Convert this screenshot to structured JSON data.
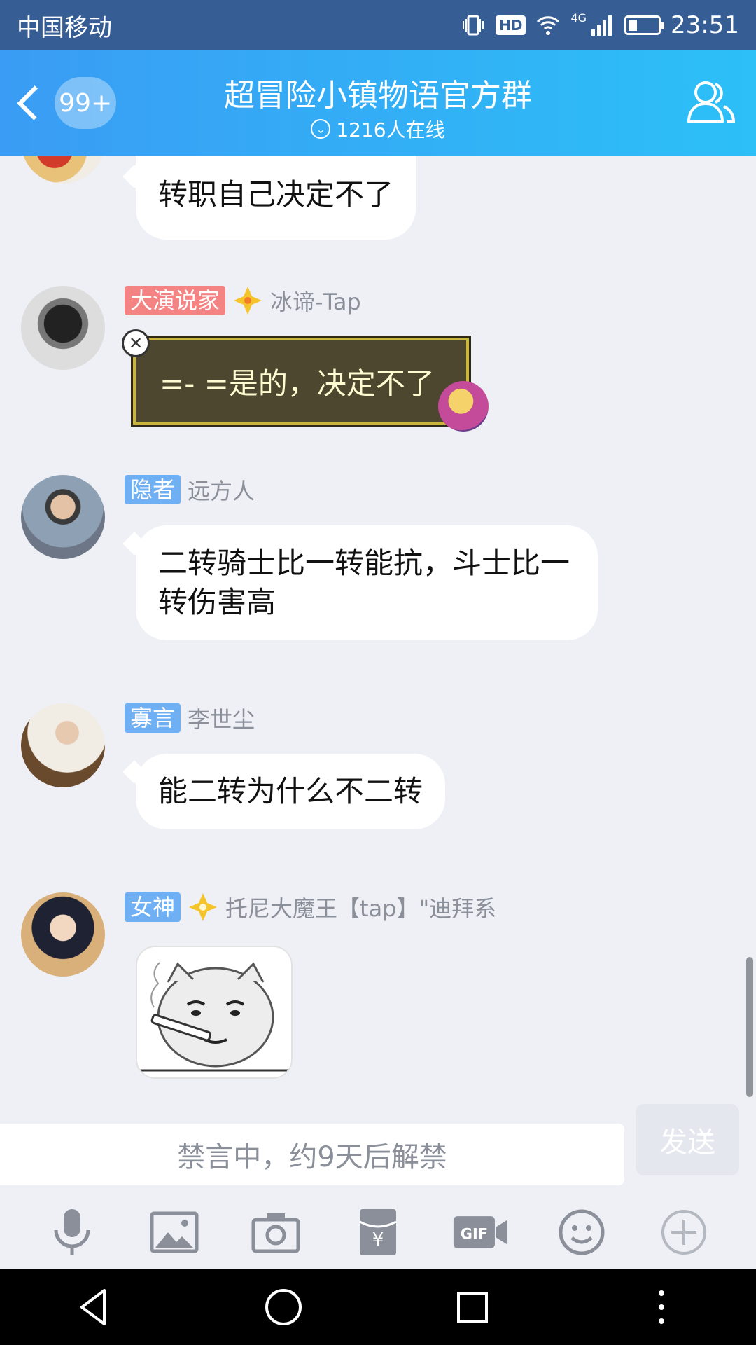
{
  "status_bar": {
    "carrier": "中国移动",
    "hd_badge": "HD",
    "network": "4G",
    "time": "23:51",
    "battery_level": 0.3
  },
  "header": {
    "back_icon": "back-chevron-icon",
    "unread_count": "99+",
    "title": "超冒险小镇物语官方群",
    "online": "1216人在线",
    "members_icon": "group-members-icon"
  },
  "messages": [
    {
      "type": "text",
      "text": "转职自己决定不了"
    },
    {
      "type": "fancy",
      "tag": "大演说家",
      "name": "冰谛-Tap",
      "text": "=- =是的，决定不了"
    },
    {
      "type": "text",
      "tag": "隐者",
      "name": "远方人",
      "text": "二转骑士比一转能抗，斗士比一转伤害高"
    },
    {
      "type": "text",
      "tag": "寡言",
      "name": "李世尘",
      "text": "能二转为什么不二转"
    },
    {
      "type": "image",
      "tag": "女神",
      "name": "托尼大魔王【tap】\"迪拜系",
      "image": "smoking-face-sticker"
    }
  ],
  "input": {
    "placeholder": "禁言中，约9天后解禁",
    "send_label": "发送"
  },
  "toolbar": [
    {
      "icon": "microphone-icon"
    },
    {
      "icon": "image-icon"
    },
    {
      "icon": "camera-icon"
    },
    {
      "icon": "red-packet-icon"
    },
    {
      "icon": "gif-icon"
    },
    {
      "icon": "emoji-icon"
    },
    {
      "icon": "plus-icon"
    }
  ],
  "colors": {
    "header_start": "#3a9cf4",
    "header_end": "#2cc0f7",
    "status_bar": "#375d95",
    "background": "#eef0f6"
  }
}
